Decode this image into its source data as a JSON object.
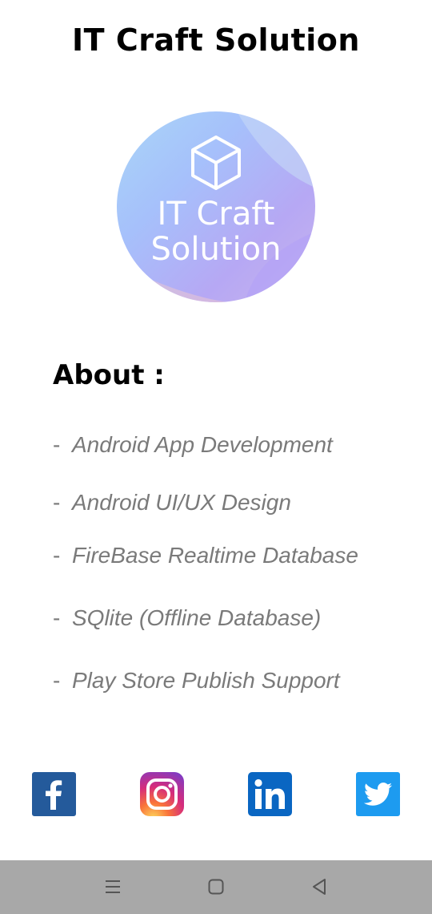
{
  "app": {
    "title": "IT Craft Solution"
  },
  "logo": {
    "line1": "IT Craft",
    "line2": "Solution"
  },
  "about": {
    "heading": "About  :",
    "dash": "-",
    "items": [
      "Android App Development",
      "Android UI/UX Design",
      "FireBase Realtime Database",
      "SQlite (Offline Database)",
      "Play Store Publish Support"
    ]
  },
  "social": [
    {
      "name": "facebook",
      "icon": "facebook-icon",
      "color": "#1877f2"
    },
    {
      "name": "instagram",
      "icon": "instagram-icon",
      "color": "#e1306c"
    },
    {
      "name": "linkedin",
      "icon": "linkedin-icon",
      "color": "#0a66c2"
    },
    {
      "name": "twitter",
      "icon": "twitter-icon",
      "color": "#1da1f2"
    }
  ],
  "nav": {
    "buttons": [
      "menu-icon",
      "home-icon",
      "back-icon"
    ]
  }
}
